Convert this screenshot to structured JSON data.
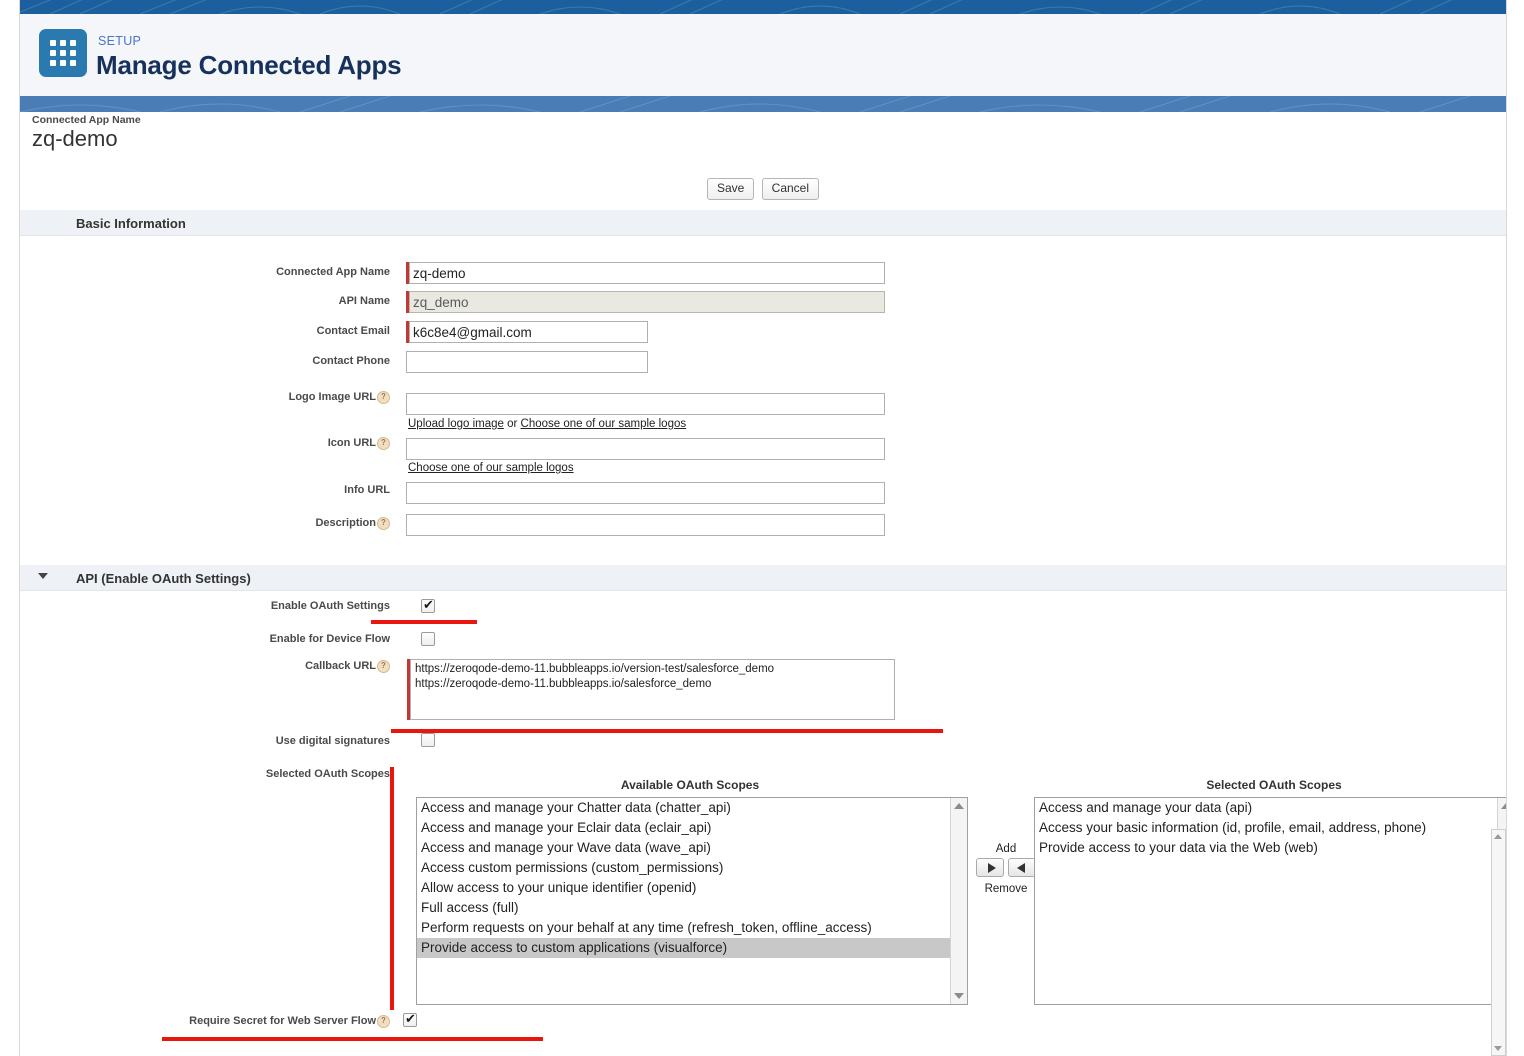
{
  "header": {
    "eyebrow": "SETUP",
    "title": "Manage Connected Apps",
    "icon": "app-grid-icon",
    "icon_bg": "#2a7ab0",
    "band_color": "#1b5f9e"
  },
  "record": {
    "label": "Connected App Name",
    "name": "zq-demo"
  },
  "actions": {
    "save": "Save",
    "cancel": "Cancel"
  },
  "sections": {
    "basic": {
      "title": "Basic Information",
      "fields": {
        "connected_app_name": {
          "label": "Connected App Name",
          "value": "zq-demo",
          "required": true
        },
        "api_name": {
          "label": "API Name",
          "value": "zq_demo",
          "required": true,
          "readonly": true
        },
        "contact_email": {
          "label": "Contact Email",
          "value": "k6c8e4@gmail.com",
          "required": true
        },
        "contact_phone": {
          "label": "Contact Phone",
          "value": ""
        },
        "logo_image_url": {
          "label": "Logo Image URL",
          "value": "",
          "help": "?"
        },
        "icon_url": {
          "label": "Icon URL",
          "value": "",
          "help": "?"
        },
        "info_url": {
          "label": "Info URL",
          "value": ""
        },
        "description": {
          "label": "Description",
          "value": "",
          "help": "?"
        }
      },
      "logo_links": {
        "upload": "Upload logo image",
        "or": "or",
        "sample": "Choose one of our sample logos"
      },
      "icon_links": {
        "sample": "Choose one of our sample logos"
      }
    },
    "api": {
      "title": "API (Enable OAuth Settings)",
      "expanded": true,
      "fields": {
        "enable_oauth": {
          "label": "Enable OAuth Settings",
          "checked": true
        },
        "enable_device_flow": {
          "label": "Enable for Device Flow",
          "checked": false
        },
        "callback_url": {
          "label": "Callback URL",
          "help": "?",
          "required": true,
          "value": "https://zeroqode-demo-11.bubbleapps.io/version-test/salesforce_demo\nhttps://zeroqode-demo-11.bubbleapps.io/salesforce_demo"
        },
        "use_digital_signatures": {
          "label": "Use digital signatures",
          "checked": false
        },
        "selected_oauth_scopes": {
          "label": "Selected OAuth Scopes",
          "required": true
        },
        "require_secret_web_server": {
          "label": "Require Secret for Web Server Flow",
          "help": "?",
          "checked": true
        }
      },
      "scopes": {
        "available_title": "Available OAuth Scopes",
        "selected_title": "Selected OAuth Scopes",
        "available": [
          {
            "text": "Access and manage your Chatter data (chatter_api)",
            "selected": false
          },
          {
            "text": "Access and manage your Eclair data (eclair_api)",
            "selected": false
          },
          {
            "text": "Access and manage your Wave data (wave_api)",
            "selected": false
          },
          {
            "text": "Access custom permissions (custom_permissions)",
            "selected": false
          },
          {
            "text": "Allow access to your unique identifier (openid)",
            "selected": false
          },
          {
            "text": "Full access (full)",
            "selected": false
          },
          {
            "text": "Perform requests on your behalf at any time (refresh_token, offline_access)",
            "selected": false
          },
          {
            "text": "Provide access to custom applications (visualforce)",
            "selected": true
          }
        ],
        "selected": [
          {
            "text": "Access and manage your data (api)",
            "selected": false
          },
          {
            "text": "Access your basic information (id, profile, email, address, phone)",
            "selected": false
          },
          {
            "text": "Provide access to your data via the Web (web)",
            "selected": false
          }
        ],
        "add_label": "Add",
        "remove_label": "Remove"
      }
    }
  },
  "annotations": {
    "color": "#e8160c",
    "count": 4
  }
}
